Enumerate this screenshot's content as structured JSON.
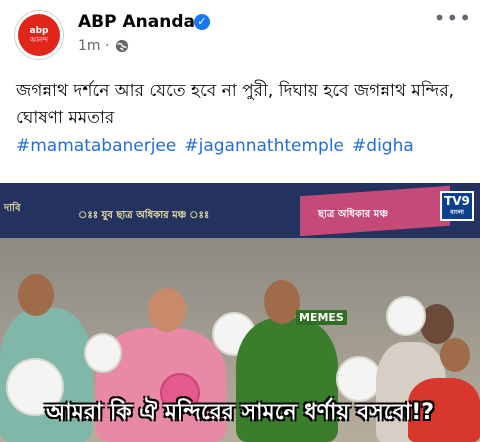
{
  "post": {
    "page_name": "ABP Ananda",
    "avatar_line1": "abp",
    "avatar_line2": "আনন্দ",
    "timestamp": "1m ·",
    "more_label": "•••",
    "verified_mark": "✓",
    "caption": "জগন্নাথ দর্শনে আর যেতে হবে না পুরী, দিঘায় হবে জগন্নাথ মন্দির, ঘোষণা মমতার",
    "hashtags": [
      "#mamatabanerjee",
      "#jagannathtemple",
      "#digha"
    ]
  },
  "media": {
    "banner_left": "দাবি",
    "banner_center": "ঃঃ যুব ছাত্র অধিকার মঞ্চ ঃঃ",
    "banner_right": "ছাত্র অধিকার মঞ্চ",
    "channel_logo": "TV9",
    "channel_sub": "বাংলা",
    "watermark": "MEMES",
    "subtitle": "আমরা কি ঐ মন্দিরের সামনে ধর্ণায় বসবো!?"
  },
  "colors": {
    "brand_red": "#e0251b",
    "link_blue": "#216fdb",
    "verified_blue": "#1877f2"
  }
}
